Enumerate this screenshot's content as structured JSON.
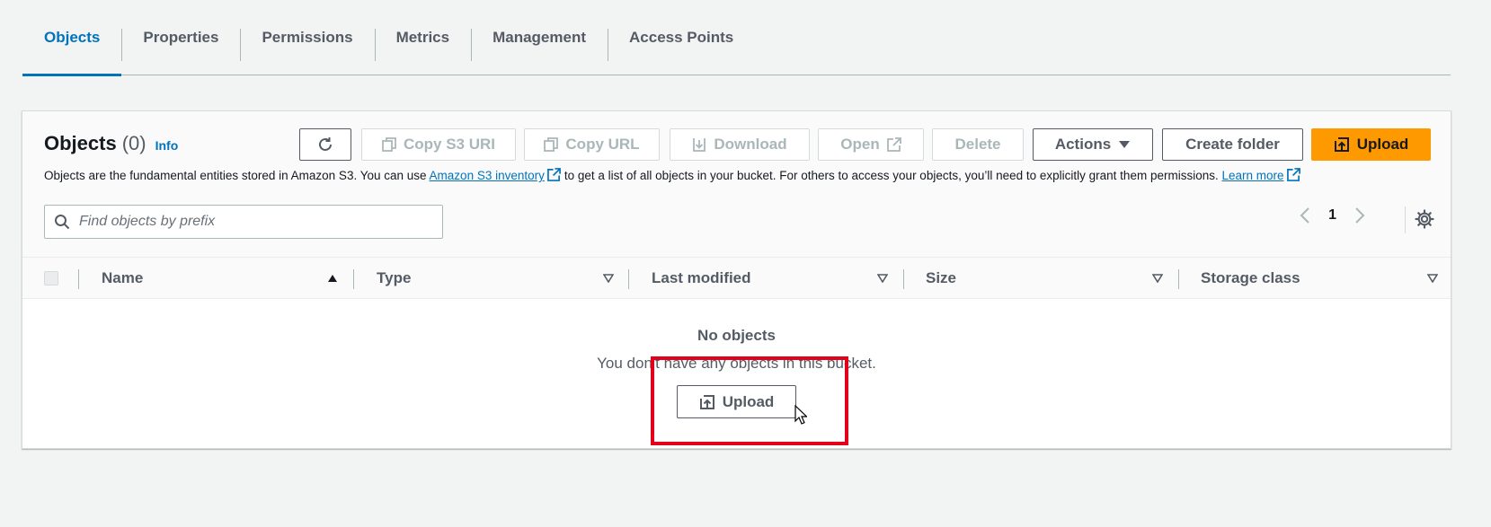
{
  "tabs": [
    {
      "label": "Objects",
      "active": true
    },
    {
      "label": "Properties"
    },
    {
      "label": "Permissions"
    },
    {
      "label": "Metrics"
    },
    {
      "label": "Management"
    },
    {
      "label": "Access Points"
    }
  ],
  "objects_panel": {
    "title": "Objects",
    "count": "(0)",
    "info_label": "Info",
    "description_pre": "Objects are the fundamental entities stored in Amazon S3. You can use",
    "inventory_link": "Amazon S3 inventory",
    "description_post": "to get a list of all objects in your bucket. For others to access your objects, you’ll need to explicitly grant them permissions.",
    "learn_more": "Learn more",
    "toolbar": {
      "copy_s3_uri": "Copy S3 URI",
      "copy_url": "Copy URL",
      "download": "Download",
      "open": "Open",
      "delete": "Delete",
      "actions": "Actions",
      "create_folder": "Create folder",
      "upload": "Upload"
    },
    "search_placeholder": "Find objects by prefix",
    "page_number": "1",
    "columns": [
      "Name",
      "Type",
      "Last modified",
      "Size",
      "Storage class"
    ],
    "empty_title": "No objects",
    "empty_subtitle": "You don't have any objects in this bucket.",
    "empty_upload": "Upload"
  },
  "colors": {
    "accent": "#0073bb",
    "primary_button": "#ff9900",
    "highlight": "#e2001a"
  }
}
